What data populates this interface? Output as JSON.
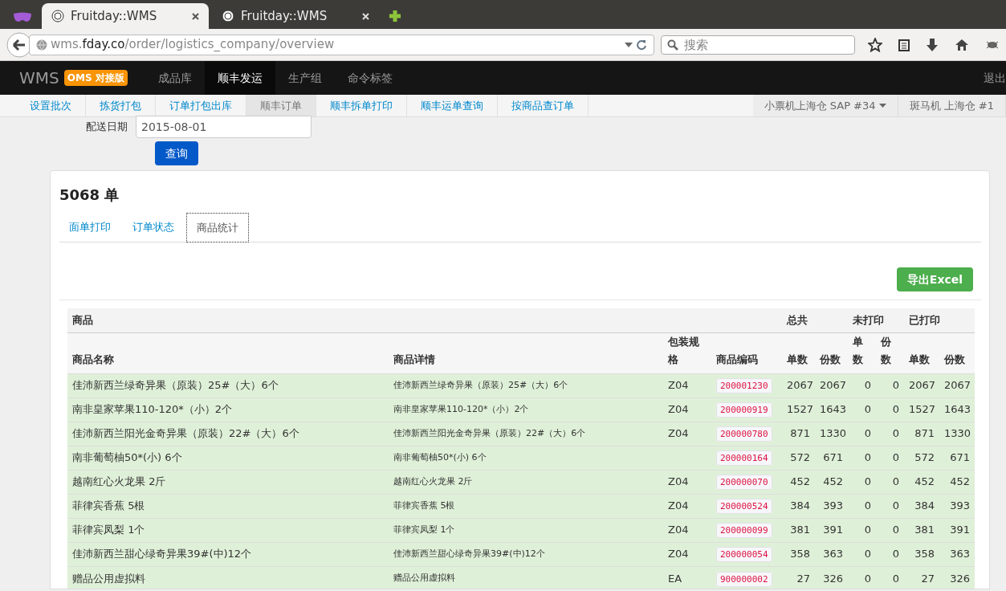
{
  "browser": {
    "tabs": [
      {
        "title": "Fruitday::WMS",
        "selected": true
      },
      {
        "title": "Fruitday::WMS",
        "selected": false
      }
    ],
    "url": [
      {
        "text": "wms.",
        "emphasis": false
      },
      {
        "text": "fday.co",
        "emphasis": true
      },
      {
        "text": "/order/logistics_company/overview",
        "emphasis": false
      }
    ],
    "search": {
      "placeholder": "搜索"
    }
  },
  "navbar": {
    "brand": "WMS",
    "badge": "OMS 对接版",
    "items": [
      {
        "label": "成品库",
        "selected": false
      },
      {
        "label": "顺丰发运",
        "selected": true
      },
      {
        "label": "生产组",
        "selected": false
      },
      {
        "label": "命令标签",
        "selected": false
      }
    ],
    "logout": "退出"
  },
  "subnav": {
    "items": [
      {
        "label": "设置批次",
        "selected": false
      },
      {
        "label": "拣货打包",
        "selected": false
      },
      {
        "label": "订单打包出库",
        "selected": false
      },
      {
        "label": "顺丰订单",
        "selected": true
      },
      {
        "label": "顺丰拆单打印",
        "selected": false
      },
      {
        "label": "顺丰运单查询",
        "selected": false
      },
      {
        "label": "按商品查订单",
        "selected": false
      }
    ],
    "printers": [
      "小票机上海仓 SAP #34",
      "斑马机 上海仓 #1"
    ]
  },
  "form": {
    "label": "配送日期",
    "value": "2015-08-01",
    "button": "查询"
  },
  "card": {
    "title": "5068 单",
    "tabs": [
      {
        "label": "面单打印",
        "selected": false
      },
      {
        "label": "订单状态",
        "selected": false
      },
      {
        "label": "商品统计",
        "selected": true
      }
    ],
    "export_button": "导出Excel",
    "table": {
      "groups": [
        "商品",
        "总共",
        "未打印",
        "已打印"
      ],
      "columns": [
        "商品名称",
        "商品详情",
        "包装规格",
        "商品编码",
        "单数",
        "份数",
        "单数",
        "份数",
        "单数",
        "份数"
      ],
      "rows": [
        [
          "佳沛新西兰绿奇异果（原装）25#（大）6个",
          "佳沛新西兰绿奇异果（原装）25#（大）6个",
          "Z04",
          "200001230",
          "2067",
          "2067",
          "0",
          "0",
          "2067",
          "2067"
        ],
        [
          "南非皇家苹果110-120*（小）2个",
          "南非皇家苹果110-120*（小）2个",
          "Z04",
          "200000919",
          "1527",
          "1643",
          "0",
          "0",
          "1527",
          "1643"
        ],
        [
          "佳沛新西兰阳光金奇异果（原装）22#（大）6个",
          "佳沛新西兰阳光金奇异果（原装）22#（大）6个",
          "Z04",
          "200000780",
          "871",
          "1330",
          "0",
          "0",
          "871",
          "1330"
        ],
        [
          "南非葡萄柚50*(小) 6个",
          "南非葡萄柚50*(小) 6个",
          "",
          "200000164",
          "572",
          "671",
          "0",
          "0",
          "572",
          "671"
        ],
        [
          "越南红心火龙果 2斤",
          "越南红心火龙果 2斤",
          "Z04",
          "200000070",
          "452",
          "452",
          "0",
          "0",
          "452",
          "452"
        ],
        [
          "菲律宾香蕉 5根",
          "菲律宾香蕉 5根",
          "Z04",
          "200000524",
          "384",
          "393",
          "0",
          "0",
          "384",
          "393"
        ],
        [
          "菲律宾凤梨 1个",
          "菲律宾凤梨 1个",
          "Z04",
          "200000099",
          "381",
          "391",
          "0",
          "0",
          "381",
          "391"
        ],
        [
          "佳沛新西兰甜心绿奇异果39#(中)12个",
          "佳沛新西兰甜心绿奇异果39#(中)12个",
          "Z04",
          "200000054",
          "358",
          "363",
          "0",
          "0",
          "358",
          "363"
        ],
        [
          "赠品公用虚拟料",
          "赠品公用虚拟料",
          "EA",
          "900000002",
          "27",
          "326",
          "0",
          "0",
          "27",
          "326"
        ]
      ]
    }
  }
}
